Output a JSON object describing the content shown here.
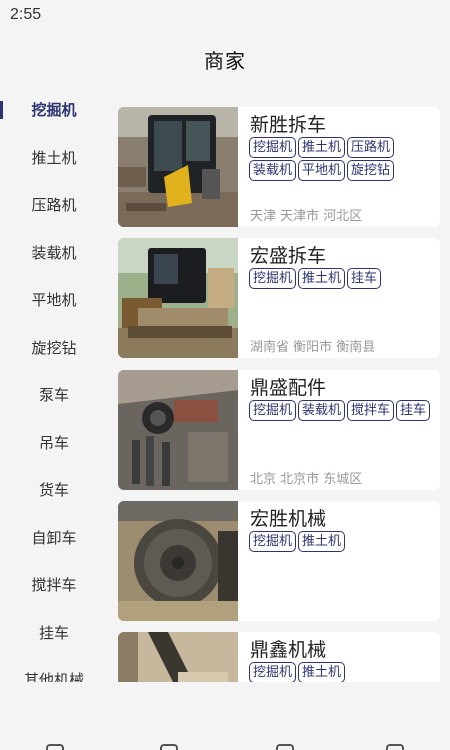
{
  "status_bar": {
    "time": "2:55"
  },
  "header": {
    "title": "商家"
  },
  "sidebar": {
    "items": [
      {
        "label": "挖掘机",
        "active": true
      },
      {
        "label": "推土机"
      },
      {
        "label": "压路机"
      },
      {
        "label": "装载机"
      },
      {
        "label": "平地机"
      },
      {
        "label": "旋挖钻"
      },
      {
        "label": "泵车"
      },
      {
        "label": "吊车"
      },
      {
        "label": "货车"
      },
      {
        "label": "自卸车"
      },
      {
        "label": "搅拌车"
      },
      {
        "label": "挂车"
      },
      {
        "label": "其他机械"
      }
    ]
  },
  "merchants": [
    {
      "name": "新胜拆车",
      "tags": [
        "挖掘机",
        "推土机",
        "压路机",
        "装载机",
        "平地机",
        "旋挖钻"
      ],
      "location": "天津 天津市 河北区",
      "photo": "yellow-excavator-cab"
    },
    {
      "name": "宏盛拆车",
      "tags": [
        "挖掘机",
        "推土机",
        "挂车"
      ],
      "location": "湖南省 衡阳市 衡南县",
      "photo": "excavator-undercarriage"
    },
    {
      "name": "鼎盛配件",
      "tags": [
        "挖掘机",
        "装载机",
        "搅拌车",
        "挂车"
      ],
      "location": "北京 北京市 东城区",
      "photo": "hydraulic-parts"
    },
    {
      "name": "宏胜机械",
      "tags": [
        "挖掘机",
        "推土机"
      ],
      "location": "",
      "photo": "travel-motor"
    },
    {
      "name": "鼎鑫机械",
      "tags": [
        "挖掘机",
        "推土机"
      ],
      "location": "",
      "photo": "excavator-arm"
    }
  ]
}
